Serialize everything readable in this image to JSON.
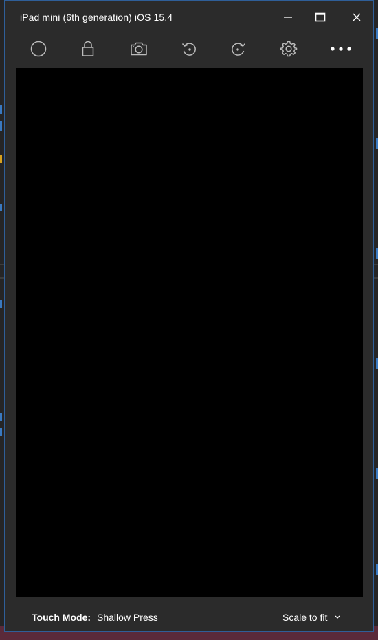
{
  "window": {
    "title": "iPad mini (6th generation) iOS 15.4"
  },
  "toolbar": {
    "buttons": [
      {
        "icon": "home-circle-icon"
      },
      {
        "icon": "lock-icon"
      },
      {
        "icon": "camera-icon"
      },
      {
        "icon": "rotate-left-icon"
      },
      {
        "icon": "rotate-right-icon"
      },
      {
        "icon": "gear-icon"
      },
      {
        "icon": "more-icon"
      }
    ]
  },
  "footer": {
    "touch_mode_label": "Touch Mode:",
    "touch_mode_value": "Shallow Press",
    "scale_value": "Scale to fit"
  },
  "colors": {
    "window_bg": "#2b2b2b",
    "screen_bg": "#000000",
    "border": "#2f5f99",
    "text": "#ffffff"
  }
}
